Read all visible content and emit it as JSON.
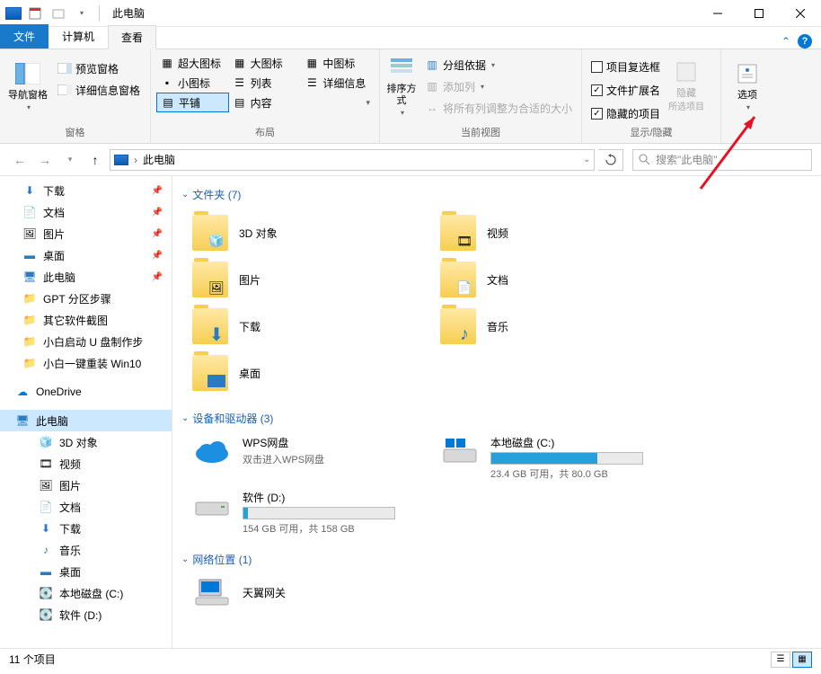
{
  "window": {
    "title": "此电脑"
  },
  "tabs": {
    "file": "文件",
    "computer": "计算机",
    "view": "查看"
  },
  "ribbon": {
    "pane": {
      "nav": "导航窗格",
      "preview": "预览窗格",
      "details": "详细信息窗格",
      "group": "窗格"
    },
    "layout": {
      "extralarge": "超大图标",
      "large": "大图标",
      "medium": "中图标",
      "small": "小图标",
      "list": "列表",
      "details": "详细信息",
      "tiles": "平铺",
      "content": "内容",
      "group": "布局"
    },
    "view": {
      "sort": "排序方式",
      "groupby": "分组依据",
      "addcol": "添加列",
      "sizecols": "将所有列调整为合适的大小",
      "group": "当前视图"
    },
    "showhide": {
      "checkboxes": "项目复选框",
      "extensions": "文件扩展名",
      "hidden": "隐藏的项目",
      "hide": "隐藏",
      "hidesel": "所选项目",
      "group": "显示/隐藏"
    },
    "options": "选项"
  },
  "addr": {
    "path": "此电脑",
    "sep": "›"
  },
  "search": {
    "placeholder": "搜索\"此电脑\""
  },
  "sidebar": {
    "items": [
      {
        "label": "下载",
        "pin": true
      },
      {
        "label": "文档",
        "pin": true
      },
      {
        "label": "图片",
        "pin": true
      },
      {
        "label": "桌面",
        "pin": true
      },
      {
        "label": "此电脑",
        "pin": true
      },
      {
        "label": "GPT 分区步骤"
      },
      {
        "label": "其它软件截图"
      },
      {
        "label": "小白启动 U 盘制作步"
      },
      {
        "label": "小白一键重装 Win10"
      }
    ],
    "onedrive": "OneDrive",
    "thispc": "此电脑",
    "pcitems": [
      {
        "label": "3D 对象"
      },
      {
        "label": "视频"
      },
      {
        "label": "图片"
      },
      {
        "label": "文档"
      },
      {
        "label": "下载"
      },
      {
        "label": "音乐"
      },
      {
        "label": "桌面"
      },
      {
        "label": "本地磁盘 (C:)"
      },
      {
        "label": "软件 (D:)"
      }
    ]
  },
  "content": {
    "sec_folders": "文件夹 (7)",
    "folders": [
      {
        "label": "3D 对象"
      },
      {
        "label": "视频"
      },
      {
        "label": "图片"
      },
      {
        "label": "文档"
      },
      {
        "label": "下载"
      },
      {
        "label": "音乐"
      },
      {
        "label": "桌面"
      }
    ],
    "sec_drives": "设备和驱动器 (3)",
    "drives": {
      "wps": {
        "name": "WPS网盘",
        "sub": "双击进入WPS网盘"
      },
      "c": {
        "name": "本地磁盘 (C:)",
        "sub": "23.4 GB 可用，共 80.0 GB"
      },
      "d": {
        "name": "软件 (D:)",
        "sub": "154 GB 可用，共 158 GB"
      }
    },
    "sec_network": "网络位置 (1)",
    "network": {
      "name": "天翼网关"
    }
  },
  "status": {
    "text": "11 个项目"
  }
}
